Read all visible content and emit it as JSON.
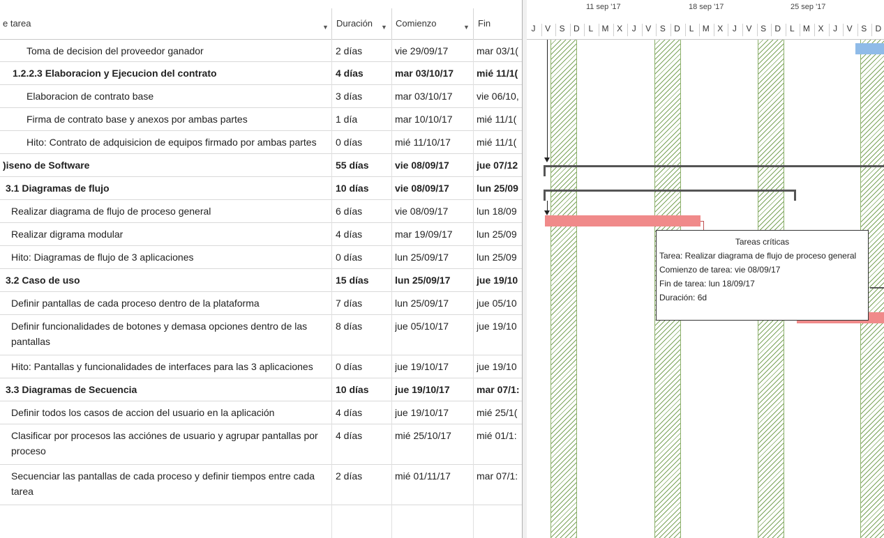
{
  "columns": {
    "name": "e tarea",
    "duration": "Duración",
    "start": "Comienzo",
    "end": "Fin"
  },
  "rows": [
    {
      "name": "Toma de decision del proveedor ganador",
      "duration": "2 días",
      "start": "vie 29/09/17",
      "end": "mar 03/1(",
      "bold": false,
      "indent": 34
    },
    {
      "name": "1.2.2.3 Elaboracion y Ejecucion del contrato",
      "duration": "4 días",
      "start": "mar 03/10/17",
      "end": "mié 11/1(",
      "bold": true,
      "indent": 14
    },
    {
      "name": "Elaboracion de contrato base",
      "duration": "3 días",
      "start": "mar 03/10/17",
      "end": "vie 06/10,",
      "bold": false,
      "indent": 34
    },
    {
      "name": "Firma de contrato base y anexos por ambas partes",
      "duration": "1 día",
      "start": "mar 10/10/17",
      "end": "mié 11/1(",
      "bold": false,
      "indent": 34
    },
    {
      "name": "Hito: Contrato de adquisicion de equipos firmado por ambas partes",
      "duration": "0 días",
      "start": "mié 11/10/17",
      "end": "mié 11/1(",
      "bold": false,
      "indent": 34
    },
    {
      "name": ")iseno de Software",
      "duration": "55 días",
      "start": "vie 08/09/17",
      "end": "jue 07/12",
      "bold": true,
      "indent": 0
    },
    {
      "name": "3.1 Diagramas de flujo",
      "duration": "10 días",
      "start": "vie 08/09/17",
      "end": "lun 25/09",
      "bold": true,
      "indent": 4
    },
    {
      "name": "Realizar diagrama de flujo de proceso general",
      "duration": "6 días",
      "start": "vie 08/09/17",
      "end": "lun 18/09",
      "bold": false,
      "indent": 12
    },
    {
      "name": "Realizar digrama modular",
      "duration": "4 días",
      "start": "mar 19/09/17",
      "end": "lun 25/09",
      "bold": false,
      "indent": 12
    },
    {
      "name": "Hito: Diagramas de flujo de 3 aplicaciones",
      "duration": "0 días",
      "start": "lun 25/09/17",
      "end": "lun 25/09",
      "bold": false,
      "indent": 12
    },
    {
      "name": "3.2 Caso de uso",
      "duration": "15 días",
      "start": "lun 25/09/17",
      "end": "jue 19/10",
      "bold": true,
      "indent": 4
    },
    {
      "name": "Definir pantallas de cada proceso dentro de la plataforma",
      "duration": "7 días",
      "start": "lun 25/09/17",
      "end": "jue 05/10",
      "bold": false,
      "indent": 12
    },
    {
      "name": "Definir funcionalidades de botones y demasa opciones dentro de las pantallas",
      "duration": "8 días",
      "start": "jue 05/10/17",
      "end": "jue 19/10",
      "bold": false,
      "indent": 12
    },
    {
      "name": "Hito: Pantallas y funcionalidades de interfaces para las 3 aplicaciones",
      "duration": "0 días",
      "start": "jue 19/10/17",
      "end": "jue 19/10",
      "bold": false,
      "indent": 12
    },
    {
      "name": "3.3 Diagramas de Secuencia",
      "duration": "10 días",
      "start": "jue 19/10/17",
      "end": "mar 07/1:",
      "bold": true,
      "indent": 4
    },
    {
      "name": "Definir todos los casos de accion del usuario en la aplicación",
      "duration": "4 días",
      "start": "jue 19/10/17",
      "end": "mié 25/1(",
      "bold": false,
      "indent": 12
    },
    {
      "name": "Clasificar por procesos las acciónes de usuario y agrupar pantallas por proceso",
      "duration": "4 días",
      "start": "mié 25/10/17",
      "end": "mié 01/1:",
      "bold": false,
      "indent": 12
    },
    {
      "name": "Secuenciar las pantallas de cada proceso y definir tiempos entre cada tarea",
      "duration": "2 días",
      "start": "mié 01/11/17",
      "end": "mar 07/1:",
      "bold": false,
      "indent": 12
    }
  ],
  "gantt": {
    "weeks": [
      "11 sep '17",
      "18 sep '17",
      "25 sep '17"
    ],
    "days": [
      "J",
      "V",
      "S",
      "D",
      "L",
      "M",
      "X",
      "J",
      "V",
      "S",
      "D",
      "L",
      "M",
      "X",
      "J",
      "V",
      "S",
      "D",
      "L",
      "M",
      "X",
      "J",
      "V",
      "S",
      "D"
    ],
    "critical_color": "#f08a8a",
    "normal_color": "#8fbbe8",
    "summary_color": "#555555",
    "weekend_color": "#7aa35a"
  },
  "tooltip": {
    "title": "Tareas críticas",
    "task": "Tarea: Realizar diagrama de flujo de proceso general",
    "start": "Comienzo de tarea: vie 08/09/17",
    "end": "Fin de tarea: lun 18/09/17",
    "duration": "Duración: 6d"
  }
}
